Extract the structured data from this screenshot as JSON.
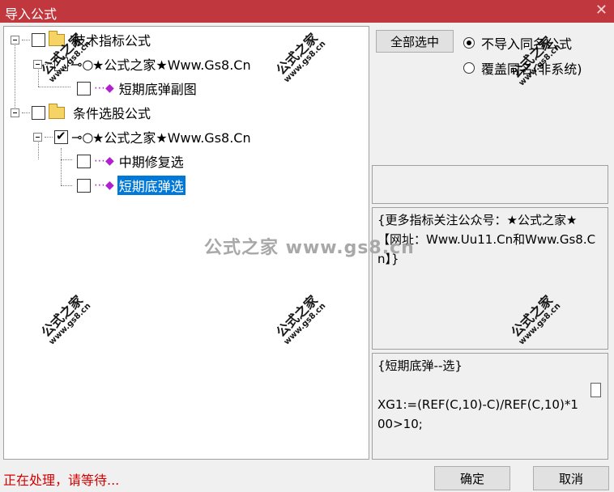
{
  "window": {
    "title": "导入公式",
    "close_glyph": "✕"
  },
  "tree": {
    "nodes": [
      {
        "label": "技术指标公式"
      },
      {
        "label": "★公式之家★Www.Gs8.Cn"
      },
      {
        "label": "短期底弹副图"
      },
      {
        "label": "条件选股公式"
      },
      {
        "label": "★公式之家★Www.Gs8.Cn"
      },
      {
        "label": "中期修复选"
      },
      {
        "label": "短期底弹选"
      }
    ]
  },
  "right": {
    "select_all_button": "全部选中",
    "options": [
      {
        "label": "不导入同名公式",
        "selected": true
      },
      {
        "label": "覆盖同名(非系统)",
        "selected": false
      }
    ],
    "description": "{更多指标关注公众号：★公式之家★ 【网址：Www.Uu11.Cn和Www.Gs8.Cn】}",
    "formula": "{短期底弹--选}\n\nXG1:=(REF(C,10)-C)/REF(C,10)*100>10;"
  },
  "status": "正在处理，请等待...",
  "buttons": {
    "ok": "确定",
    "cancel": "取消"
  },
  "watermark": {
    "line1": "公式之家",
    "line2": "www.gs8.cn",
    "center": "公式之家 www.gs8.cn"
  }
}
